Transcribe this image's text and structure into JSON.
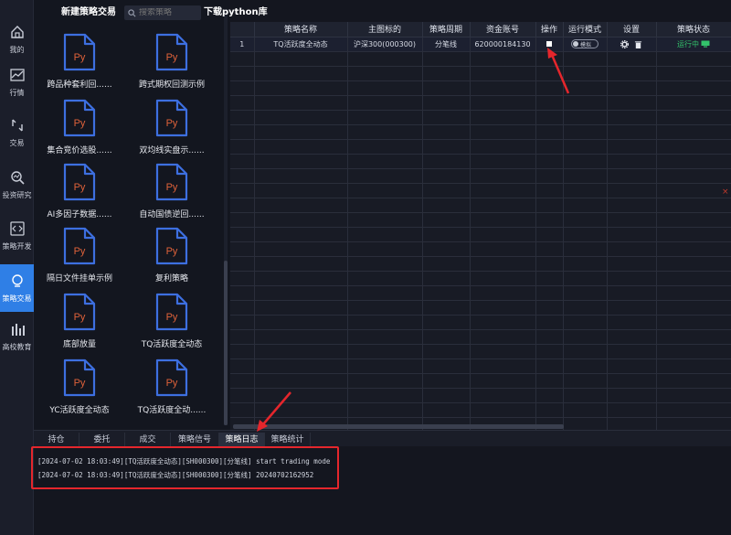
{
  "sidebar": {
    "items": [
      {
        "label": "我的",
        "icon": "home-icon"
      },
      {
        "label": "行情",
        "icon": "chart-icon"
      },
      {
        "label": "交易",
        "icon": "trade-icon"
      },
      {
        "label": "投资研究",
        "icon": "research-icon"
      },
      {
        "label": "策略开发",
        "icon": "code-icon"
      },
      {
        "label": "策略交易",
        "icon": "bulb-icon",
        "active": true
      },
      {
        "label": "高校教育",
        "icon": "education-icon"
      }
    ],
    "accent": "#2f7fe6"
  },
  "library": {
    "new_strategy_label": "新建策略交易",
    "search_placeholder": "搜索策略",
    "file_badge": "Py",
    "files": [
      "跨品种套利回......",
      "跨式期权回测示例",
      "集合竞价选股......",
      "双均线实盘示......",
      "AI多因子数据......",
      "自动国债逆回......",
      "隔日文件挂单示例",
      "复利策略",
      "底部放量",
      "TQ活跃度全动态",
      "YC活跃度全动态",
      "TQ活跃度全动......"
    ]
  },
  "download_link": "下载python库",
  "table": {
    "headers": [
      "",
      "策略名称",
      "主图标的",
      "策略周期",
      "资金账号",
      "操作",
      "运行模式",
      "设置",
      "策略状态"
    ],
    "rows": [
      {
        "index": "1",
        "name": "TQ活跃度全动态",
        "symbol": "沪深300(000300)",
        "period": "分笔线",
        "account": "620000184130",
        "mode_label": "模拟",
        "status": "运行中"
      }
    ],
    "empty_rows": 26,
    "status_color": "#33c26b"
  },
  "bottom_tabs": [
    "持仓",
    "委托",
    "成交",
    "策略信号",
    "策略日志",
    "策略统计"
  ],
  "active_tab": "策略日志",
  "log": {
    "lines": [
      "[2024-07-02 18:03:49][TQ活跃度全动态][SH000300][分笔线] start trading mode",
      "[2024-07-02 18:03:49][TQ活跃度全动态][SH000300][分笔线] 20240702162952"
    ]
  },
  "annotation_color": "#e5262c",
  "edge_mark": "×"
}
